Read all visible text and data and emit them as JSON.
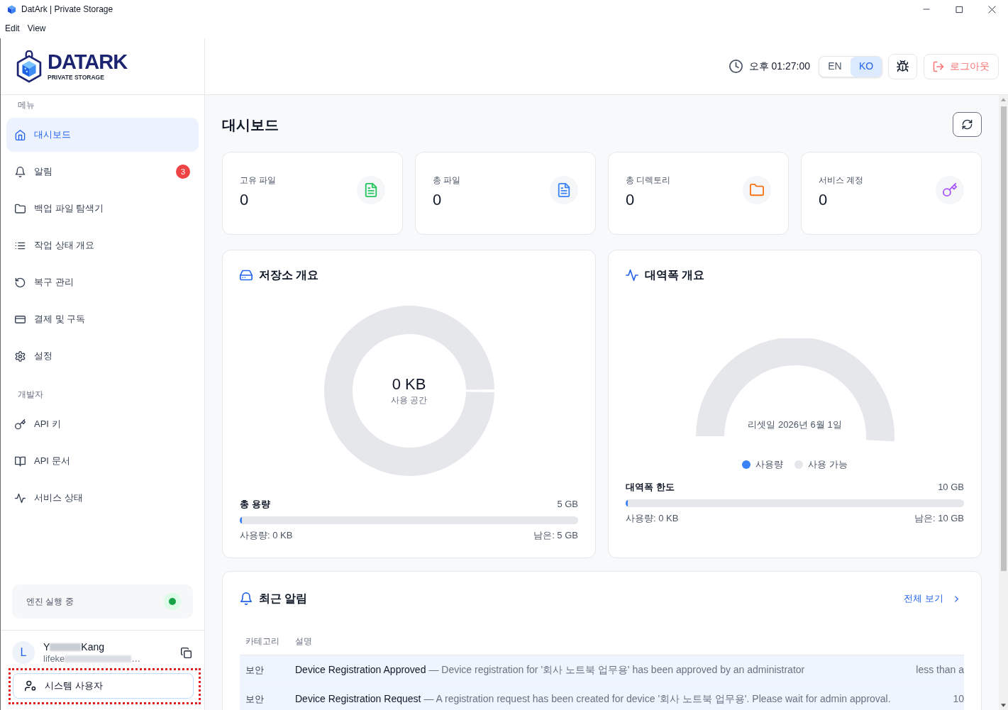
{
  "window": {
    "title": "DatArk | Private Storage"
  },
  "menu_bar": [
    {
      "label": "Edit"
    },
    {
      "label": "View"
    }
  ],
  "sidebar": {
    "logo": {
      "wordmark": "DATARK",
      "tagline": "PRIVATE STORAGE"
    },
    "sections": [
      {
        "label": "메뉴",
        "items": [
          {
            "label": "대시보드",
            "selected": true
          },
          {
            "label": "알림",
            "selected": false,
            "badge": "3"
          },
          {
            "label": "백업 파일 탐색기",
            "selected": false
          },
          {
            "label": "작업 상태 개요",
            "selected": false
          },
          {
            "label": "복구 관리",
            "selected": false
          },
          {
            "label": "결제 및 구독",
            "selected": false
          },
          {
            "label": "설정",
            "selected": false
          }
        ]
      },
      {
        "label": "개발자",
        "items": [
          {
            "label": "API 키",
            "selected": false
          },
          {
            "label": "API 문서",
            "selected": false
          },
          {
            "label": "서비스 상태",
            "selected": false
          }
        ]
      }
    ],
    "engine_status": {
      "label": "엔진 실행 중",
      "running": true
    },
    "user": {
      "avatar": "L",
      "name_before_blur": "Y",
      "name_after_blur": "Kang",
      "email_before_blur": "lifeke",
      "email_after_blur": "…"
    },
    "role_button": {
      "label": "시스템 사용자",
      "annotated": true
    }
  },
  "header": {
    "time": "오후 01:27:00",
    "languages": [
      {
        "label": "EN",
        "selected": false
      },
      {
        "label": "KO",
        "selected": true
      }
    ],
    "logout": "로그아웃"
  },
  "page_title": "대시보드",
  "stats": [
    {
      "label": "고유 파일",
      "value": "0",
      "color": "#22c55e"
    },
    {
      "label": "총 파일",
      "value": "0",
      "color": "#3b82f6"
    },
    {
      "label": "총 디렉토리",
      "value": "0",
      "color": "#f97316"
    },
    {
      "label": "서비스 계정",
      "value": "0",
      "color": "#a855f7"
    }
  ],
  "storage": {
    "title": "저장소 개요",
    "ring": {
      "value": "0 KB",
      "caption": "사용 공간"
    },
    "total_label": "총 용량",
    "total_value": "5 GB",
    "bar": {
      "level": 0
    },
    "used": "사용량: 0 KB",
    "remaining": "남은: 5 GB"
  },
  "bandwidth": {
    "title": "대역폭 개요",
    "gauge": {
      "caption": "리셋일 2026년 6월 1일"
    },
    "legend": [
      {
        "label": "사용량",
        "color": "#3b82f6"
      },
      {
        "label": "사용 가능",
        "color": "#e5e7eb"
      }
    ],
    "limit_label": "대역폭 한도",
    "limit_value": "10 GB",
    "bar": {
      "level": 0
    },
    "used": "사용량: 0 KB",
    "remaining": "남은: 10 GB"
  },
  "recent_alerts": {
    "title": "최근 알림",
    "view_all": "전체 보기",
    "columns": [
      "카테고리",
      "설명"
    ],
    "rows": [
      {
        "category": "보안",
        "title": "Device Registration Approved",
        "message": "— Device registration for '회사 노트북 업무용' has been approved by an administrator",
        "time": "less than a",
        "unread": true
      },
      {
        "category": "보안",
        "title": "Device Registration Request",
        "message": "— A registration request has been created for device '회사 노트북 업무용'. Please wait for admin approval.",
        "time": "10",
        "unread": true
      }
    ]
  }
}
